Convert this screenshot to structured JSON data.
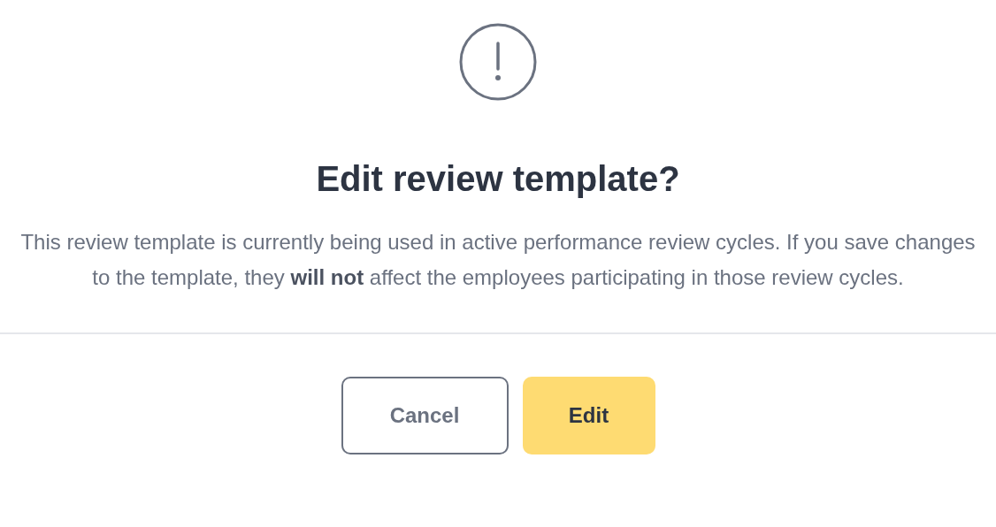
{
  "dialog": {
    "title": "Edit review template?",
    "message": "This review template is currently being used in active performance review cycles. If you save changes to the template, they **will not** affect the employees participating in those review cycles.",
    "buttons": [
      {
        "label": "Cancel",
        "kind": "secondary"
      },
      {
        "label": "Edit",
        "kind": "primary"
      }
    ]
  }
}
